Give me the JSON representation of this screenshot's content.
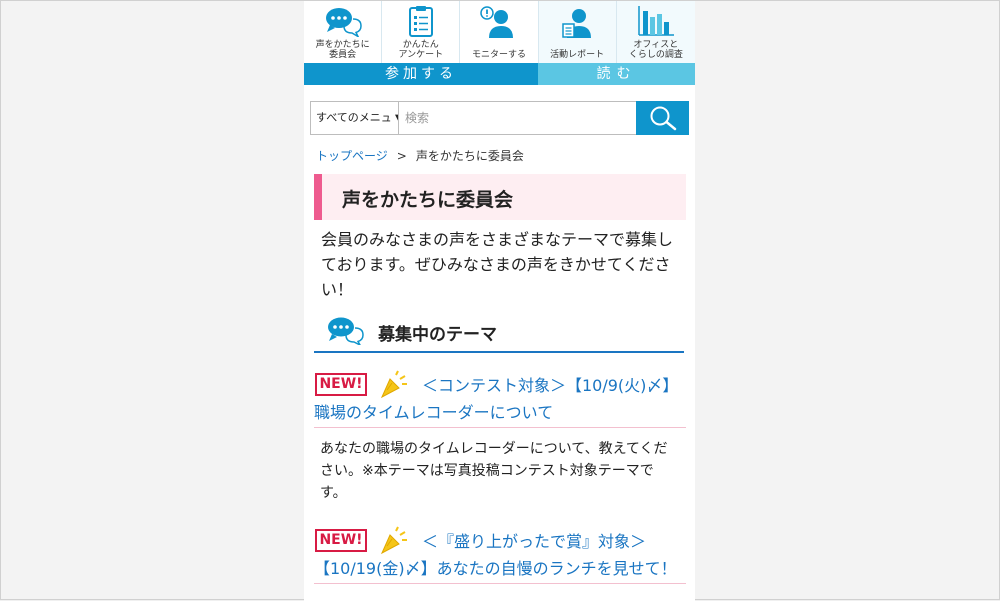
{
  "nav": {
    "items": [
      {
        "label": "声をかたちに\n委員会",
        "icon": "speech-bubbles-icon"
      },
      {
        "label": "かんたん\nアンケート",
        "icon": "clipboard-icon"
      },
      {
        "label": "モニターする",
        "icon": "person-alert-icon"
      },
      {
        "label": "活動レポート",
        "icon": "person-document-icon"
      },
      {
        "label": "オフィスと\nくらしの調査",
        "icon": "bar-chart-icon"
      }
    ],
    "tab_participate": "参加する",
    "tab_read": "読む"
  },
  "search": {
    "select_value": "すべてのメニュ",
    "placeholder": "検索"
  },
  "breadcrumb": {
    "home": "トップページ",
    "separator": ">",
    "current": "声をかたちに委員会"
  },
  "page_title": "声をかたちに委員会",
  "intro": "会員のみなさまの声をさまざまなテーマで募集しております。ぜひみなさまの声をきかせてください！",
  "section_title": "募集中のテーマ",
  "themes": [
    {
      "badge": "NEW!",
      "title": "＜コンテスト対象＞【10/9(火)〆】職場のタイムレコーダーについて",
      "description": "あなたの職場のタイムレコーダーについて、教えてください。※本テーマは写真投稿コンテスト対象テーマです。"
    },
    {
      "badge": "NEW!",
      "title": "＜『盛り上がったで賞』対象＞【10/19(金)〆】あなたの自慢のランチを見せて！",
      "description": ""
    }
  ],
  "colors": {
    "brand_blue": "#0f95cc",
    "light_blue": "#5bc6e3",
    "link_blue": "#1a75c2",
    "title_pink": "#ee5b8f",
    "new_red": "#d81b44"
  }
}
